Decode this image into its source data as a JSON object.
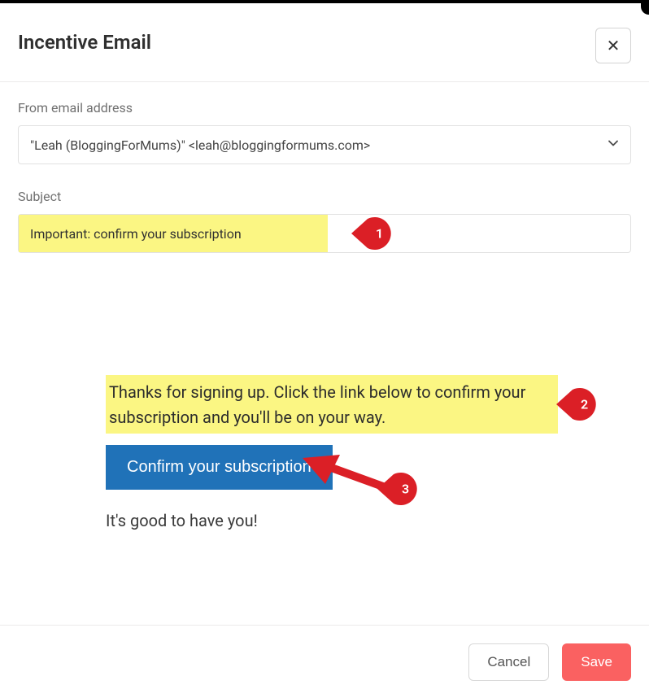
{
  "modal": {
    "title": "Incentive Email",
    "close_glyph": "✕"
  },
  "from": {
    "label": "From email address",
    "value": "\"Leah (BloggingForMums)\" <leah@bloggingformums.com>"
  },
  "subject": {
    "label": "Subject",
    "value": "Important: confirm your subscription"
  },
  "email_body": {
    "intro": "Thanks for signing up. Click the link below to confirm your subscription and you'll be on your way.",
    "button": "Confirm your subscription",
    "closing": "It's good to have you!"
  },
  "annotations": {
    "p1": "1",
    "p2": "2",
    "p3": "3"
  },
  "footer": {
    "cancel": "Cancel",
    "save": "Save"
  }
}
